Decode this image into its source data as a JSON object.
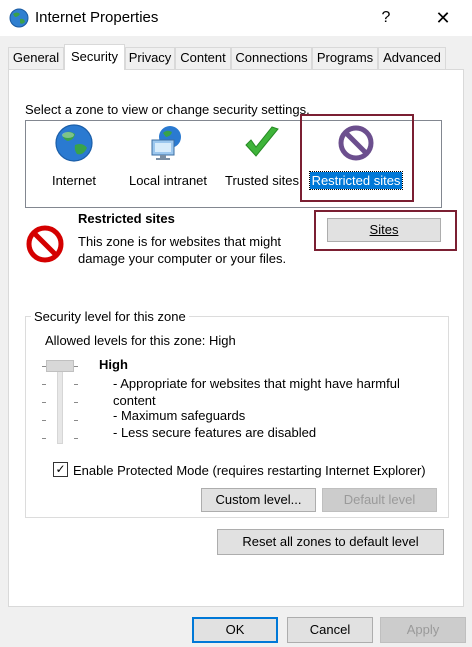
{
  "window": {
    "title": "Internet Properties",
    "help_glyph": "?",
    "close_glyph": "✕"
  },
  "tabs": [
    {
      "label": "General"
    },
    {
      "label": "Security",
      "active": true
    },
    {
      "label": "Privacy"
    },
    {
      "label": "Content"
    },
    {
      "label": "Connections"
    },
    {
      "label": "Programs"
    },
    {
      "label": "Advanced"
    }
  ],
  "zones": {
    "prompt": "Select a zone to view or change security settings.",
    "items": [
      {
        "label": "Internet",
        "icon": "globe-icon"
      },
      {
        "label": "Local intranet",
        "icon": "intranet-icon"
      },
      {
        "label": "Trusted sites",
        "icon": "checkmark-icon"
      },
      {
        "label": "Restricted sites",
        "icon": "restricted-icon",
        "selected": true
      }
    ]
  },
  "zone_info": {
    "name": "Restricted sites",
    "description": "This zone is for websites that might damage your computer or your files.",
    "sites_button": "Sites"
  },
  "security_level": {
    "group_title": "Security level for this zone",
    "allowed": "Allowed levels for this zone: High",
    "level": "High",
    "level_fraction": 1.0,
    "descriptions": [
      "- Appropriate for websites that might have harmful",
      "content",
      "- Maximum safeguards",
      "- Less secure features are disabled"
    ],
    "protected_mode_label": "Enable Protected Mode (requires restarting Internet Explorer)",
    "protected_mode_checked": true,
    "custom_level_button": "Custom level...",
    "default_level_button": "Default level"
  },
  "reset_button": "Reset all zones to default level",
  "footer": {
    "ok": "OK",
    "cancel": "Cancel",
    "apply": "Apply"
  },
  "colors": {
    "accent": "#0078d7",
    "highlight_border": "#7b1f32",
    "restricted_red": "#d40000"
  }
}
